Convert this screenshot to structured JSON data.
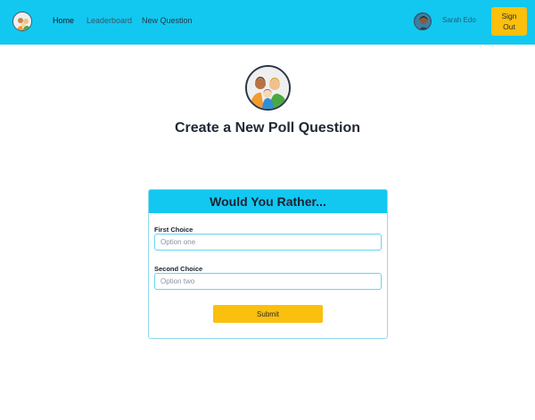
{
  "nav": {
    "links": [
      {
        "label": "Home",
        "active": true
      },
      {
        "label": "Leaderboard",
        "active": false
      },
      {
        "label": "New Question",
        "active": false
      }
    ],
    "user_name": "Sarah Edo",
    "signout_label": "Sign Out"
  },
  "main": {
    "title": "Create a New Poll Question",
    "card": {
      "header": "Would You Rather...",
      "first_label": "First Choice",
      "first_placeholder": "Option one",
      "first_value": "",
      "second_label": "Second Choice",
      "second_placeholder": "Option two",
      "second_value": "",
      "submit_label": "Submit"
    }
  },
  "colors": {
    "header_bg": "#12c8f0",
    "accent_button": "#fbbf0d",
    "input_border": "#6ad3ef"
  },
  "icons": {
    "app_logo": "group-avatar-icon",
    "user_avatar": "user-avatar-icon"
  }
}
